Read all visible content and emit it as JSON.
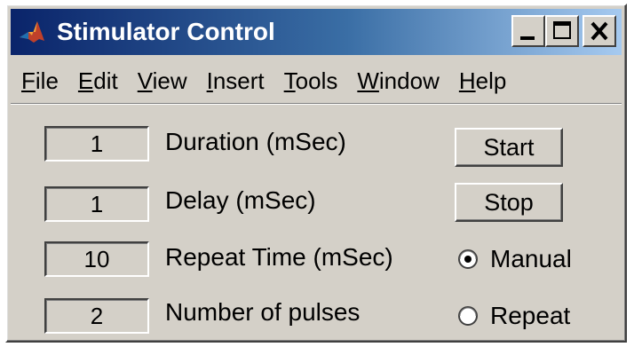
{
  "window": {
    "title": "Stimulator Control",
    "icon": "matlab-icon",
    "controls": [
      "minimize-icon",
      "maximize-icon",
      "close-icon"
    ]
  },
  "menu": {
    "items": [
      {
        "label": "File",
        "underline": "F",
        "rest": "ile"
      },
      {
        "label": "Edit",
        "underline": "E",
        "rest": "dit"
      },
      {
        "label": "View",
        "underline": "V",
        "rest": "iew"
      },
      {
        "label": "Insert",
        "underline": "I",
        "rest": "nsert"
      },
      {
        "label": "Tools",
        "underline": "T",
        "rest": "ools"
      },
      {
        "label": "Window",
        "underline": "W",
        "rest": "indow"
      },
      {
        "label": "Help",
        "underline": "H",
        "rest": "elp"
      }
    ]
  },
  "fields": {
    "duration": {
      "value": "1",
      "label": "Duration (mSec)"
    },
    "delay": {
      "value": "1",
      "label": "Delay (mSec)"
    },
    "repeat_time": {
      "value": "10",
      "label": "Repeat Time (mSec)"
    },
    "pulses": {
      "value": "2",
      "label": "Number of pulses"
    }
  },
  "buttons": {
    "start": "Start",
    "stop": "Stop"
  },
  "mode": {
    "manual": {
      "label": "Manual",
      "selected": true
    },
    "repeat": {
      "label": "Repeat",
      "selected": false
    }
  },
  "colors": {
    "face": "#d4d0c8",
    "title_start": "#0a246a",
    "title_end": "#a6caf0"
  }
}
